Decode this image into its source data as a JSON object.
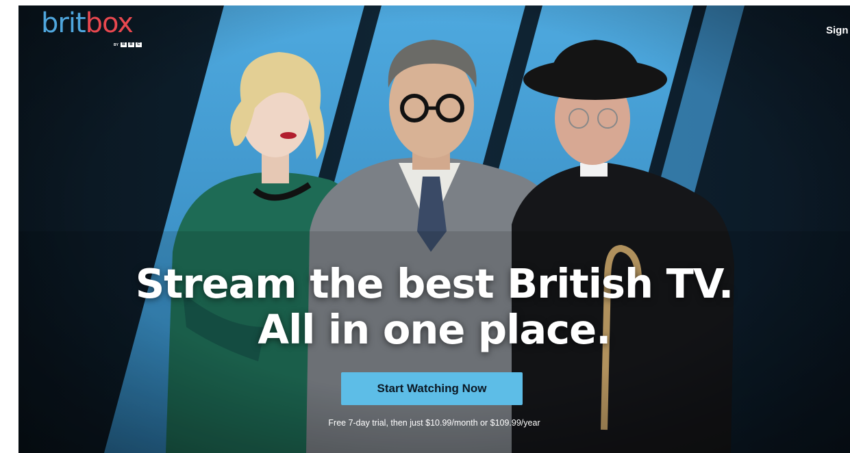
{
  "brand": {
    "logo_part1": "brit",
    "logo_part2": "box",
    "byline": "BY",
    "bbc_letters": [
      "B",
      "B",
      "C"
    ]
  },
  "header": {
    "signin_label": "Sign"
  },
  "hero": {
    "headline_line1": "Stream the best British TV.",
    "headline_line2": "All in one place.",
    "cta_label": "Start Watching Now",
    "pricing_note": "Free 7-day trial, then just $10.99/month or $109.99/year"
  },
  "colors": {
    "background": "#0b1824",
    "stripe_blue": "#4aa7de",
    "logo_blue": "#4fa6dd",
    "logo_red": "#e8484f",
    "cta_background": "#5dbde7"
  }
}
